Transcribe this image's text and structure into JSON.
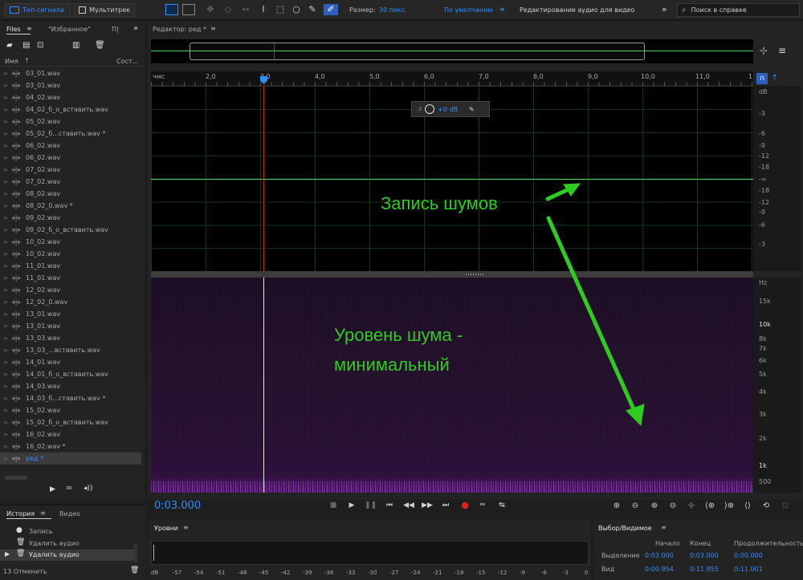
{
  "toolbar": {
    "waveform_label": "Тип сигнала",
    "multitrack_label": "Мультитрек",
    "size_label": "Размер:",
    "size_value": "30 пикс.",
    "workspace_label": "По умолчанию",
    "workspace_menu": "≡",
    "workspace_name": "Редактирование аудио для видео",
    "more_label": "»",
    "search_placeholder": "Поиск в справке"
  },
  "files_panel": {
    "tab_files": "Files",
    "tab_menu": "≡",
    "tab_favorites": "\"Избранное\"",
    "tab_more": "П|",
    "collapse_label": "»",
    "col_name": "Имя",
    "sort_arrow": "↑",
    "col_status": "Сост...",
    "items": [
      "03_01.wav",
      "03_01.wav",
      "04_02.wav",
      "04_02_б_о_вставить.wav",
      "05_02.wav",
      "05_02_б...ставить.wav *",
      "06_02.wav",
      "06_02.wav",
      "07_02.wav",
      "07_02.wav",
      "08_02.wav",
      "08_02_0.wav *",
      "09_02.wav",
      "09_02_б_о_вставить.wav",
      "10_02.wav",
      "10_02.wav",
      "11_01.wav",
      "11_01.wav",
      "12_02.wav",
      "12_02_0.wav",
      "13_01.wav",
      "13_01.wav",
      "13_03.wav",
      "13_03_...вставить.wav",
      "14_01.wav",
      "14_01_б_о_вставить.wav",
      "14_03.wav",
      "14_03_б...ставить.wav *",
      "15_02.wav",
      "15_02_б_о_вставить.wav",
      "16_02.wav",
      "16_02.wav *",
      "ред *"
    ]
  },
  "editor": {
    "tab_title": "Редактор: ред *",
    "tab_menu": "≡",
    "ruler_unit": "чмс",
    "ruler_ticks": [
      "2,0",
      "3,0",
      "4,0",
      "5,0",
      "6,0",
      "7,0",
      "8,0",
      "9,0",
      "10,0",
      "11,0",
      "1"
    ],
    "hud_gain": "+0 dB",
    "db_scale": [
      "dB",
      "-3",
      "-6",
      "-9",
      "-12",
      "-18",
      "-∞",
      "-18",
      "-12",
      "-9",
      "-6",
      "-3"
    ],
    "hz_scale": [
      "Hz",
      "15k",
      "10k",
      "8k",
      "7k",
      "6k",
      "5k",
      "4k",
      "3k",
      "2k",
      "1k",
      "500"
    ],
    "time_display": "0:03.000"
  },
  "annotations": {
    "noise_record": "Запись шумов",
    "noise_level_line1": "Уровень шума -",
    "noise_level_line2": "минимальный"
  },
  "history": {
    "tab_history": "История",
    "tab_menu": "≡",
    "tab_video": "Видео",
    "items": [
      "Запись",
      "Удалить аудио",
      "Удалить аудио"
    ],
    "undo_count": "13 Отменить"
  },
  "levels": {
    "title": "Уровни",
    "menu": "≡",
    "scale": [
      "dB",
      "-57",
      "-54",
      "-51",
      "-48",
      "-45",
      "-42",
      "-39",
      "-36",
      "-33",
      "-30",
      "-27",
      "-24",
      "-21",
      "-18",
      "-15",
      "-12",
      "-9",
      "-6",
      "-3",
      "0"
    ]
  },
  "selection_view": {
    "title": "Выбор/Видимое",
    "menu": "≡",
    "col_start": "Начало",
    "col_end": "Конец",
    "col_duration": "Продолжительность",
    "row_selection": "Выделение",
    "row_view": "Вид",
    "sel_start": "0:03.000",
    "sel_end": "0:03.000",
    "sel_duration": "0:00.000",
    "view_start": "0:00.954",
    "view_end": "0:11.955",
    "view_duration": "0:11.001"
  },
  "colors": {
    "accent_blue": "#2f8fff",
    "waveform_green": "#4fd36b",
    "playhead_red": "#d21f1f",
    "annotation_green": "#2ecc1e"
  }
}
